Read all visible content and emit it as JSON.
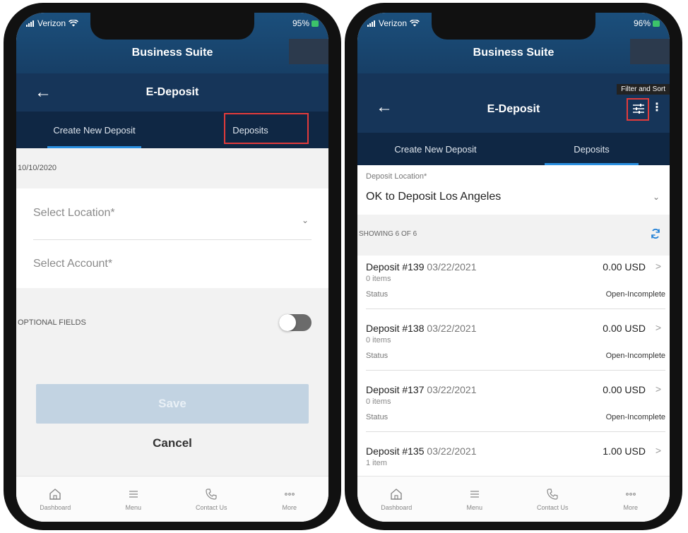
{
  "colors": {
    "header_blue": "#1b4f7c",
    "edeposit_blue": "#163559",
    "tab_bar_navy": "#0f2744",
    "active_tab_underline": "#2a8fe0",
    "highlight_red": "#e23b3b",
    "save_disabled": "#c2d3e2",
    "refresh_blue": "#1f7fd6",
    "battery_green": "#3cc36a"
  },
  "left": {
    "status": {
      "carrier": "Verizon",
      "battery": "95%"
    },
    "header": {
      "suite_title": "Business Suite",
      "page_title": "E-Deposit"
    },
    "tabs": {
      "create": "Create New Deposit",
      "deposits": "Deposits",
      "active": "Create New Deposit"
    },
    "date": "10/10/2020",
    "fields": {
      "location_placeholder": "Select Location",
      "account_placeholder": "Select Account"
    },
    "optional_fields": {
      "label": "OPTIONAL FIELDS",
      "enabled": false
    },
    "actions": {
      "save": "Save",
      "cancel": "Cancel"
    },
    "nav": {
      "dashboard": "Dashboard",
      "menu": "Menu",
      "contact": "Contact Us",
      "more": "More"
    },
    "icons": [
      "wifi-icon",
      "signal-icon",
      "back-arrow-icon",
      "chevron-down-icon",
      "house-icon",
      "hamburger-icon",
      "phone-icon",
      "more-dots-icon"
    ]
  },
  "right": {
    "status": {
      "carrier": "Verizon",
      "battery": "96%"
    },
    "header": {
      "suite_title": "Business Suite",
      "page_title": "E-Deposit",
      "filter_tip": "Filter and Sort"
    },
    "tabs": {
      "create": "Create New Deposit",
      "deposits": "Deposits",
      "active": "Deposits"
    },
    "location": {
      "label": "Deposit Location",
      "value": "OK to Deposit Los Angeles"
    },
    "showing": "SHOWING 6 OF 6",
    "status_label": "Status",
    "deposits": [
      {
        "name": "Deposit #139",
        "date": "03/22/2021",
        "amount": "0.00 USD",
        "items": "0 items",
        "status": "Open-Incomplete"
      },
      {
        "name": "Deposit #138",
        "date": "03/22/2021",
        "amount": "0.00 USD",
        "items": "0 items",
        "status": "Open-Incomplete"
      },
      {
        "name": "Deposit #137",
        "date": "03/22/2021",
        "amount": "0.00 USD",
        "items": "0 items",
        "status": "Open-Incomplete"
      },
      {
        "name": "Deposit #135",
        "date": "03/22/2021",
        "amount": "1.00 USD",
        "items": "1 item",
        "status": ""
      }
    ],
    "nav": {
      "dashboard": "Dashboard",
      "menu": "Menu",
      "contact": "Contact Us",
      "more": "More"
    },
    "icons": [
      "filter-sliders-icon",
      "kebab-menu-icon",
      "refresh-icon",
      "chevron-right-icon"
    ]
  }
}
